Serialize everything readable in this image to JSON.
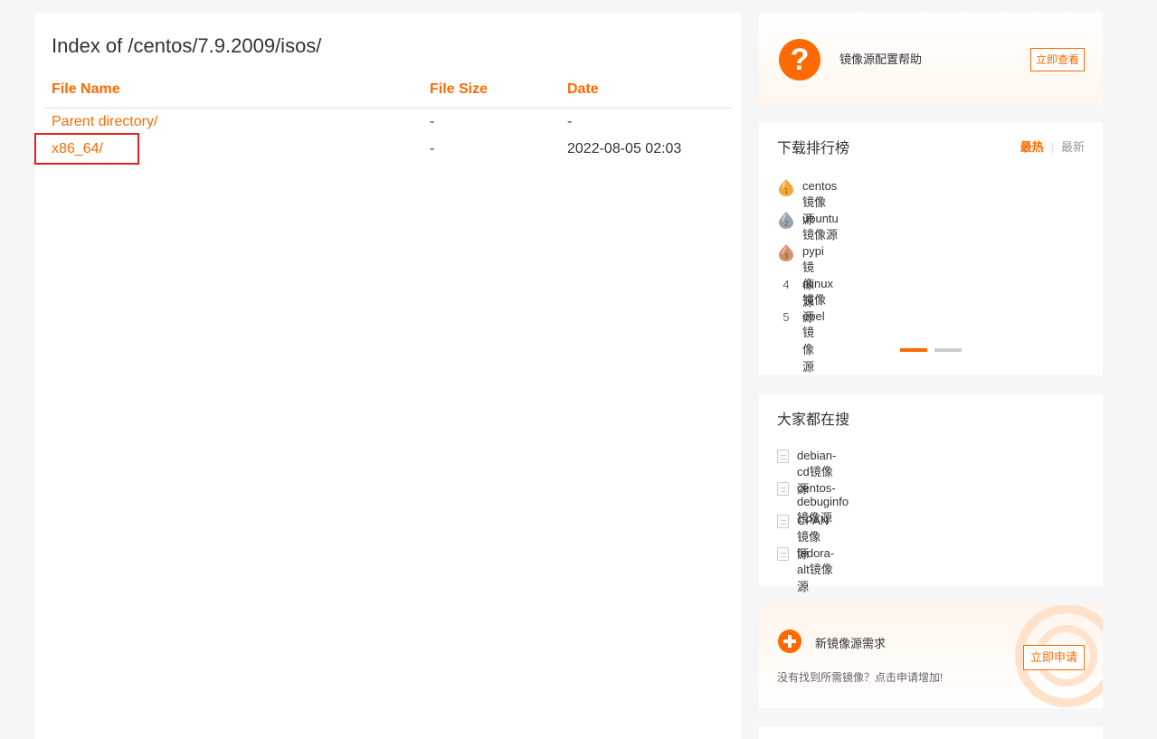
{
  "main": {
    "title": "Index of /centos/7.9.2009/isos/",
    "columns": [
      "File Name",
      "File Size",
      "Date"
    ],
    "rows": [
      {
        "name": "Parent directory/",
        "size": "-",
        "date": "-"
      },
      {
        "name": "x86_64/",
        "size": "-",
        "date": "2022-08-05 02:03"
      }
    ]
  },
  "help_card": {
    "icon": "question-circle-icon",
    "text": "镜像源配置帮助",
    "button": "立即查看"
  },
  "ranking": {
    "title": "下载排行榜",
    "tabs": [
      "最热",
      "最新"
    ],
    "active_tab": 0,
    "items": [
      {
        "rank": "1",
        "label": "centos镜像源"
      },
      {
        "rank": "2",
        "label": "ubuntu镜像源"
      },
      {
        "rank": "3",
        "label": "pypi镜像源"
      },
      {
        "rank": "4",
        "label": "alinux镜像源"
      },
      {
        "rank": "5",
        "label": "epel镜像源"
      }
    ],
    "pages": 2,
    "active_page": 0
  },
  "popular": {
    "title": "大家都在搜",
    "items": [
      "debian-cd镜像源",
      "centos-debuginfo镜像源",
      "CPAN镜像源",
      "fedora-alt镜像源"
    ]
  },
  "request_card": {
    "icon": "plus-circle-icon",
    "title": "新镜像源需求",
    "subtitle": "没有找到所需镜像？点击申请增加!",
    "button": "立即申请"
  },
  "colors": {
    "accent": "#ff6a00",
    "highlight": "#e02020",
    "gold": "#f3a53a",
    "silver": "#9aa3ad",
    "bronze": "#d38f6a"
  }
}
